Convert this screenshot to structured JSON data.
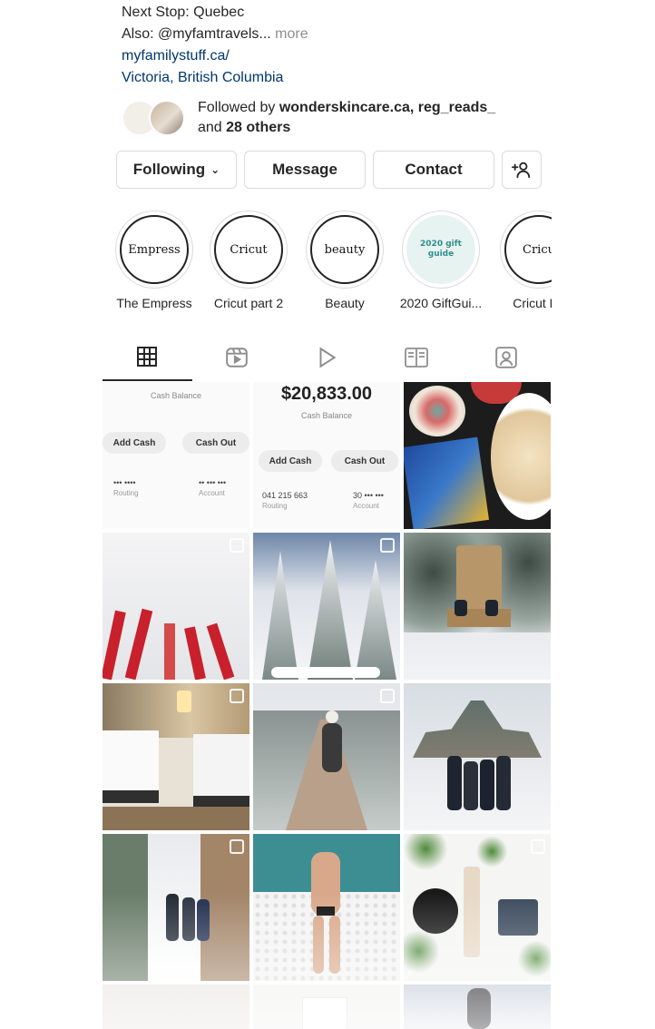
{
  "bio": {
    "line1": "Next Stop: Quebec",
    "line2": "Also: @myfamtravels...",
    "more": "more",
    "link": "myfamilystuff.ca/",
    "location": "Victoria, British Columbia"
  },
  "followed_by": {
    "prefix": "Followed by",
    "names": "wonderskincare.ca, reg_reads_",
    "and": "and",
    "others": "28 others"
  },
  "actions": {
    "following": "Following",
    "message": "Message",
    "contact": "Contact"
  },
  "highlights": [
    {
      "label": "The Empress",
      "cover": "Empress"
    },
    {
      "label": "Cricut part 2",
      "cover": "Cricut"
    },
    {
      "label": "Beauty",
      "cover": "beauty"
    },
    {
      "label": "2020 GiftGui...",
      "cover": "2020 gift guide"
    },
    {
      "label": "Cricut Pa",
      "cover": "Cricu"
    }
  ],
  "tabs": [
    {
      "name": "grid",
      "icon": "grid-icon"
    },
    {
      "name": "reels",
      "icon": "reels-icon"
    },
    {
      "name": "video",
      "icon": "play-icon"
    },
    {
      "name": "guides",
      "icon": "guides-icon"
    },
    {
      "name": "tagged",
      "icon": "tagged-icon"
    }
  ],
  "posts": {
    "p1": {
      "caption": "Cash Balance",
      "add_cash": "Add Cash",
      "cash_out": "Cash Out",
      "routing": "Routing",
      "account": "Account"
    },
    "p2": {
      "balance": "$20,833.00",
      "caption": "Cash Balance",
      "add_cash": "Add Cash",
      "cash_out": "Cash Out",
      "routing_num": "041 215 663",
      "routing": "Routing",
      "account_num": "30 ••• •••",
      "account": "Account"
    }
  },
  "colors": {
    "text": "#262626",
    "muted": "#8e8e8e",
    "link": "#00376b",
    "border": "#dbdbdb"
  }
}
